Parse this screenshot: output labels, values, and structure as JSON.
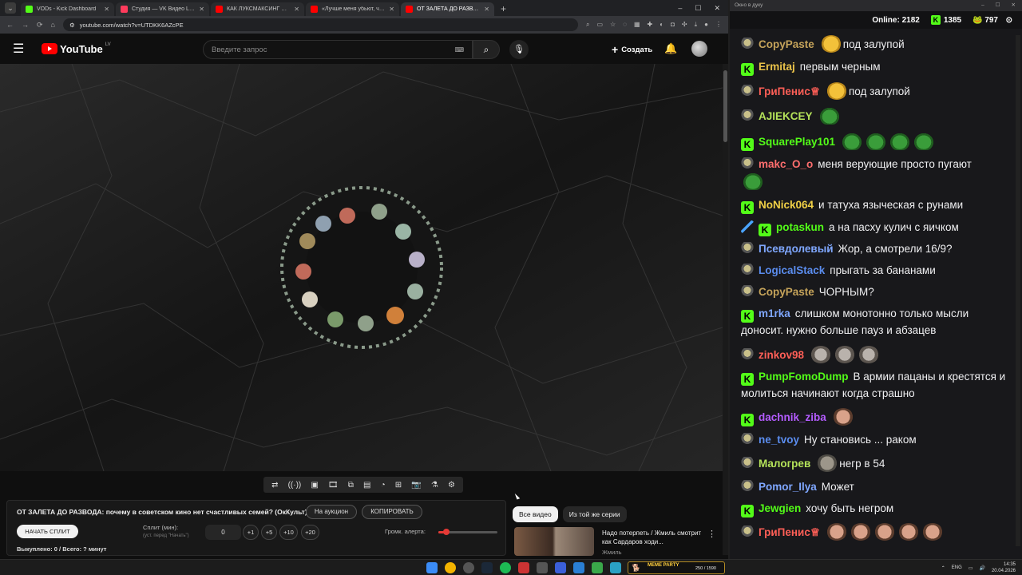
{
  "browser": {
    "tabs": [
      {
        "label": "VODs - Kick Dashboard",
        "color": "#53fc18"
      },
      {
        "label": "Студия — VK Видео Live",
        "color": "#ff3b5c"
      },
      {
        "label": "КАК ЛУКСМАКСИНГ СДЕЛАЛ",
        "color": "#ff0000"
      },
      {
        "label": "«Лучше меня убьют, чем на",
        "color": "#ff0000"
      },
      {
        "label": "ОТ ЗАЛЕТА ДО РАЗВОДА: поч",
        "color": "#ff0000"
      }
    ],
    "url": "youtube.com/watch?v=UTDKK6AZcPE"
  },
  "youtube": {
    "logo": "YouTube",
    "region": "LV",
    "search_placeholder": "Введите запрос",
    "create_label": "Создать"
  },
  "extension": {
    "title": "ОТ ЗАЛЕТА ДО РАЗВОДА: почему в советском кино нет счастливых семей? (ОкКульт)",
    "auction_label": "На аукцион",
    "copy_label": "КОПИРОВАТЬ",
    "start_split_label": "НАЧАТЬ СПЛИТ",
    "split_label": "Сплит (мин):",
    "split_hint": "(уст. перед \"Начать\")",
    "split_value": "0",
    "steps": [
      "+1",
      "+5",
      "+10",
      "+20"
    ],
    "alert_volume_label": "Громк. алерта:",
    "alert_volume": 0.1,
    "bought_text": "Выкуплено: 0 / Всего: ? минут"
  },
  "related": {
    "chips": [
      "Все видео",
      "Из той же серии"
    ],
    "video_title": "Надо потерпеть / Жмиль смотрит как Сардаров ходи...",
    "channel": "Жмиль"
  },
  "chat": {
    "window_title": "Окно в дуку",
    "online_label": "Online:",
    "online": "2182",
    "kick_count": "1385",
    "frog_count": "797",
    "messages": [
      {
        "user": "CopyPaste",
        "color": "#c5a35a",
        "badge": "frog",
        "pre_emotes": [
          "e-yellow"
        ],
        "text": "под залупой",
        "post_emotes": []
      },
      {
        "user": "Ermitaj",
        "color": "#e9c24a",
        "badge": "kick",
        "pre_emotes": [],
        "text": "первым черным",
        "post_emotes": []
      },
      {
        "user": "ГриПенис♕",
        "color": "#ff5f57",
        "badge": "frog",
        "pre_emotes": [
          "e-yellow"
        ],
        "text": "под залупой",
        "post_emotes": []
      },
      {
        "user": "AJIEKCEY",
        "color": "#b5e35a",
        "badge": "frog",
        "pre_emotes": [
          "e-frog"
        ],
        "text": "",
        "post_emotes": []
      },
      {
        "user": "SquarePlay101",
        "color": "#53fc18",
        "badge": "kick",
        "pre_emotes": [
          "e-frog",
          "e-frog",
          "e-frog",
          "e-frog"
        ],
        "text": "",
        "post_emotes": []
      },
      {
        "user": "makc_O_o",
        "color": "#ff6e6e",
        "badge": "frog",
        "pre_emotes": [],
        "text": "меня верующие просто пугают",
        "post_emotes": [
          "e-frog"
        ]
      },
      {
        "user": "NoNick064",
        "color": "#f0d046",
        "badge": "kick",
        "pre_emotes": [],
        "text": "и татуха языческая с рунами",
        "post_emotes": []
      },
      {
        "user": "potaskun",
        "color": "#53fc18",
        "badge": "sword",
        "pre_emotes": [],
        "text": "а на пасху кулич с яичком",
        "post_emotes": []
      },
      {
        "user": "Псевдолевый",
        "color": "#7fa7ff",
        "badge": "frog",
        "pre_emotes": [],
        "text": "Жор, а смотрели 16/9?",
        "post_emotes": []
      },
      {
        "user": "LogicalStack",
        "color": "#5b8def",
        "badge": "frog",
        "pre_emotes": [],
        "text": "прыгать за бананами",
        "post_emotes": []
      },
      {
        "user": "CopyPaste",
        "color": "#c5a35a",
        "badge": "frog",
        "pre_emotes": [],
        "text": "ЧОРНЫМ?",
        "post_emotes": []
      },
      {
        "user": "m1rka",
        "color": "#7fa7ff",
        "badge": "kick",
        "pre_emotes": [],
        "text": "слишком монотонно только мысли доносит. нужно больше пауз и абзацев",
        "post_emotes": []
      },
      {
        "user": "zinkov98",
        "color": "#ff5f57",
        "badge": "frog",
        "pre_emotes": [
          "e-gray",
          "e-gray",
          "e-gray"
        ],
        "text": "",
        "post_emotes": []
      },
      {
        "user": "PumpFomoDump",
        "color": "#53fc18",
        "badge": "kick",
        "pre_emotes": [],
        "text": "В армии пацаны и крестятся и молиться начинают когда страшно",
        "post_emotes": []
      },
      {
        "user": "dachnik_ziba",
        "color": "#b45cff",
        "badge": "kick",
        "pre_emotes": [
          "e-face"
        ],
        "text": "",
        "post_emotes": []
      },
      {
        "user": "ne_tvoy",
        "color": "#5b8def",
        "badge": "frog",
        "pre_emotes": [],
        "text": "Ну становись ... раком",
        "post_emotes": []
      },
      {
        "user": "Малогрев",
        "color": "#b5e35a",
        "badge": "frog",
        "pre_emotes": [
          "e-stone"
        ],
        "text": "негр в 54",
        "post_emotes": []
      },
      {
        "user": "Pomor_Ilya",
        "color": "#7fa7ff",
        "badge": "frog",
        "pre_emotes": [],
        "text": "Может",
        "post_emotes": []
      },
      {
        "user": "Jewgien",
        "color": "#53fc18",
        "badge": "kick",
        "pre_emotes": [],
        "text": "хочу быть негром",
        "post_emotes": []
      },
      {
        "user": "ГриПенис♕",
        "color": "#ff5f57",
        "badge": "frog",
        "pre_emotes": [
          "e-face",
          "e-face",
          "e-face",
          "e-face",
          "e-face"
        ],
        "text": "",
        "post_emotes": []
      }
    ]
  },
  "taskbar": {
    "meme_title": "MEME PARTY",
    "meme_count": "250 / 1590",
    "lang": "ENG",
    "time": "14:35",
    "date": "20.04.2026"
  }
}
